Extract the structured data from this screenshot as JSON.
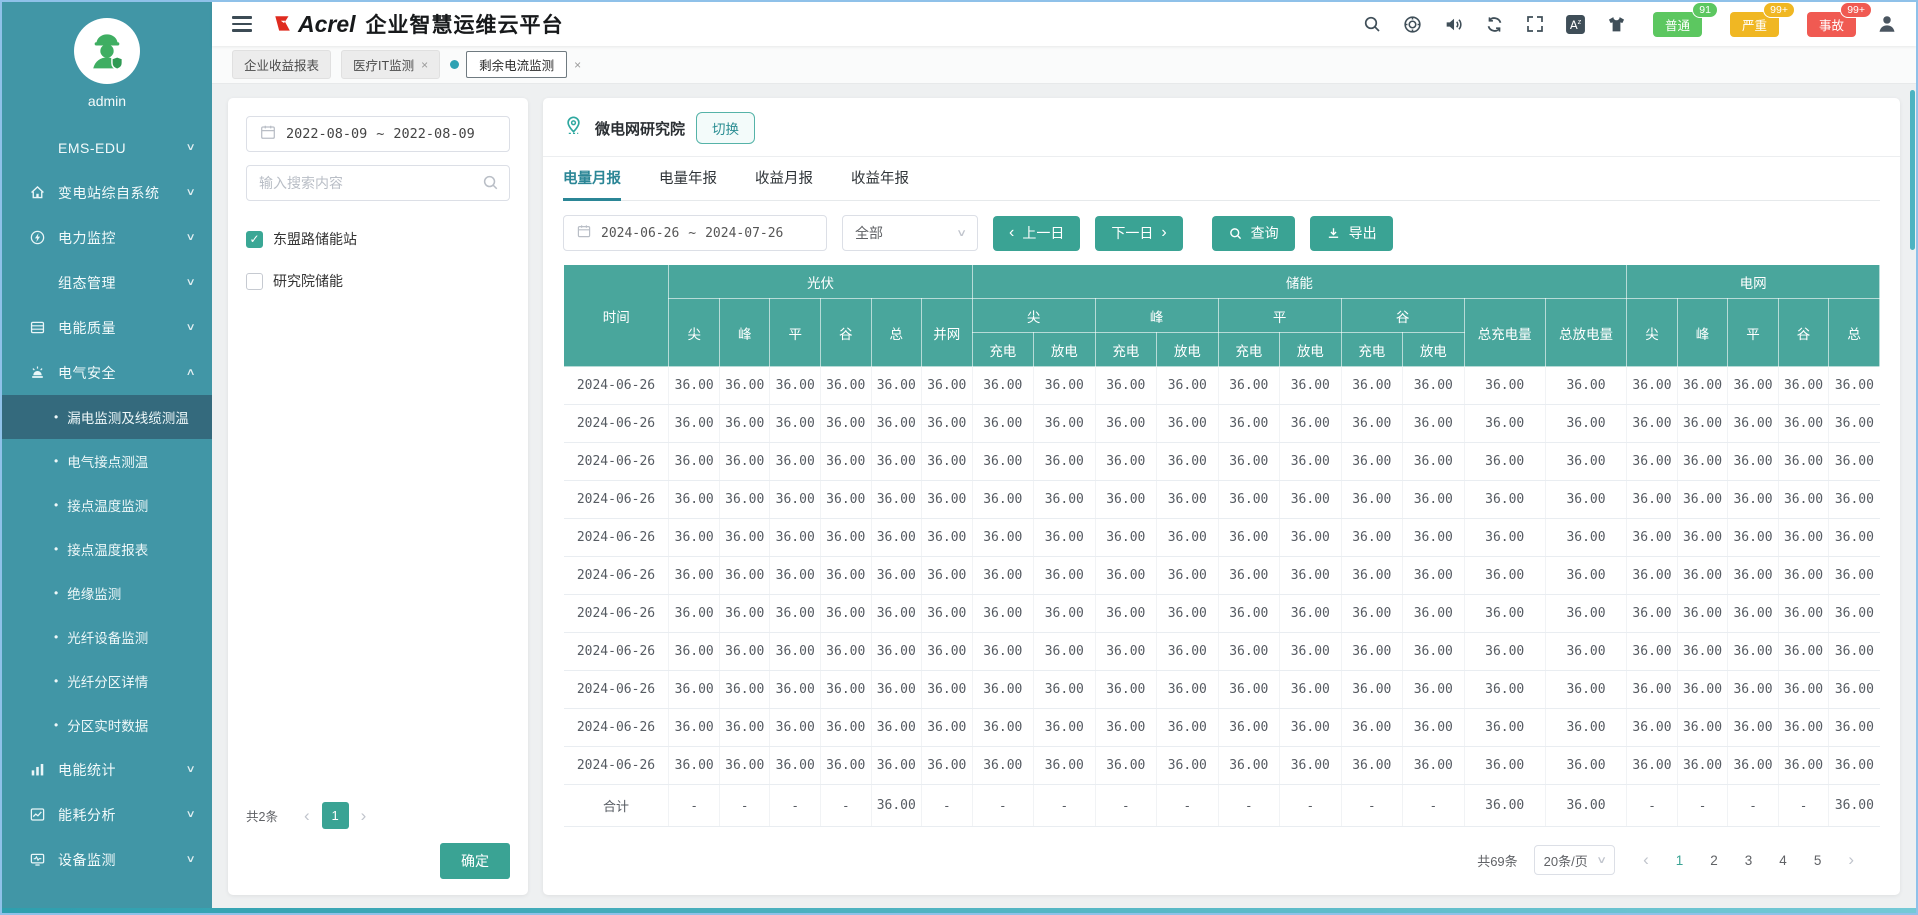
{
  "app": {
    "brand": "Acrel",
    "title": "企业智慧运维云平台"
  },
  "header": {
    "icon_names": [
      "search-icon",
      "support-icon",
      "sound-icon",
      "refresh-icon",
      "fullscreen-icon",
      "translate-icon",
      "theme-icon",
      "user-icon"
    ],
    "badges": [
      {
        "label": "普通",
        "count": "91",
        "color": "#5cc760"
      },
      {
        "label": "严重",
        "count": "99+",
        "color": "#f0b723"
      },
      {
        "label": "事故",
        "count": "99+",
        "color": "#f05a52"
      }
    ]
  },
  "workspace_tabs": [
    {
      "label": "企业收益报表",
      "active": false,
      "closable": false
    },
    {
      "label": "医疗IT监测",
      "active": false,
      "closable": true
    },
    {
      "label": "剩余电流监测",
      "active": true,
      "closable": true
    }
  ],
  "sidebar": {
    "username": "admin",
    "menu": [
      {
        "label": "EMS-EDU",
        "icon": "",
        "chevron": "down"
      },
      {
        "label": "变电站综自系统",
        "icon": "home-icon",
        "chevron": "down"
      },
      {
        "label": "电力监控",
        "icon": "power-icon",
        "chevron": "down"
      },
      {
        "label": "组态管理",
        "icon": "",
        "chevron": "down"
      },
      {
        "label": "电能质量",
        "icon": "quality-icon",
        "chevron": "down"
      },
      {
        "label": "电气安全",
        "icon": "safety-icon",
        "chevron": "up",
        "expanded": true,
        "children": [
          {
            "label": "漏电监测及线缆测温",
            "active": true
          },
          {
            "label": "电气接点测温"
          },
          {
            "label": "接点温度监测"
          },
          {
            "label": "接点温度报表"
          },
          {
            "label": "绝缘监测"
          },
          {
            "label": "光纤设备监测"
          },
          {
            "label": "光纤分区详情"
          },
          {
            "label": "分区实时数据"
          }
        ]
      },
      {
        "label": "电能统计",
        "icon": "stats-icon",
        "chevron": "down"
      },
      {
        "label": "能耗分析",
        "icon": "analysis-icon",
        "chevron": "down"
      },
      {
        "label": "设备监测",
        "icon": "device-icon",
        "chevron": "down"
      }
    ]
  },
  "filter_panel": {
    "date_start": "2022-08-09",
    "date_separator": "~",
    "date_end": "2022-08-09",
    "search_placeholder": "输入搜索内容",
    "stations": [
      {
        "label": "东盟路储能站",
        "checked": true
      },
      {
        "label": "研究院储能",
        "checked": false
      }
    ],
    "total_text": "共2条",
    "current_page": "1",
    "confirm_label": "确定"
  },
  "report": {
    "site_name": "微电网研究院",
    "switch_label": "切换",
    "tabs": [
      {
        "label": "电量月报",
        "active": true
      },
      {
        "label": "电量年报",
        "active": false
      },
      {
        "label": "收益月报",
        "active": false
      },
      {
        "label": "收益年报",
        "active": false
      }
    ],
    "toolbar": {
      "date_start": "2024-06-26",
      "date_separator": "~",
      "date_end": "2024-07-26",
      "scope_selected": "全部",
      "prev_label": "上一日",
      "next_label": "下一日",
      "query_label": "查询",
      "export_label": "导出"
    },
    "table": {
      "time_header": "时间",
      "groups": [
        {
          "label": "光伏",
          "leaf": [
            "尖",
            "峰",
            "平",
            "谷",
            "总",
            "并网"
          ]
        },
        {
          "label": "储能",
          "pairs": [
            {
              "label": "尖",
              "sub": [
                "充电",
                "放电"
              ]
            },
            {
              "label": "峰",
              "sub": [
                "充电",
                "放电"
              ]
            },
            {
              "label": "平",
              "sub": [
                "充电",
                "放电"
              ]
            },
            {
              "label": "谷",
              "sub": [
                "充电",
                "放电"
              ]
            }
          ],
          "tail": [
            "总充电量",
            "总放电量"
          ]
        },
        {
          "label": "电网",
          "leaf": [
            "尖",
            "峰",
            "平",
            "谷",
            "总"
          ]
        }
      ],
      "rows": [
        [
          "2024-06-26",
          "36.00",
          "36.00",
          "36.00",
          "36.00",
          "36.00",
          "36.00",
          "36.00",
          "36.00",
          "36.00",
          "36.00",
          "36.00",
          "36.00",
          "36.00",
          "36.00",
          "36.00",
          "36.00",
          "36.00",
          "36.00",
          "36.00",
          "36.00",
          "36.00"
        ],
        [
          "2024-06-26",
          "36.00",
          "36.00",
          "36.00",
          "36.00",
          "36.00",
          "36.00",
          "36.00",
          "36.00",
          "36.00",
          "36.00",
          "36.00",
          "36.00",
          "36.00",
          "36.00",
          "36.00",
          "36.00",
          "36.00",
          "36.00",
          "36.00",
          "36.00",
          "36.00"
        ],
        [
          "2024-06-26",
          "36.00",
          "36.00",
          "36.00",
          "36.00",
          "36.00",
          "36.00",
          "36.00",
          "36.00",
          "36.00",
          "36.00",
          "36.00",
          "36.00",
          "36.00",
          "36.00",
          "36.00",
          "36.00",
          "36.00",
          "36.00",
          "36.00",
          "36.00",
          "36.00"
        ],
        [
          "2024-06-26",
          "36.00",
          "36.00",
          "36.00",
          "36.00",
          "36.00",
          "36.00",
          "36.00",
          "36.00",
          "36.00",
          "36.00",
          "36.00",
          "36.00",
          "36.00",
          "36.00",
          "36.00",
          "36.00",
          "36.00",
          "36.00",
          "36.00",
          "36.00",
          "36.00"
        ],
        [
          "2024-06-26",
          "36.00",
          "36.00",
          "36.00",
          "36.00",
          "36.00",
          "36.00",
          "36.00",
          "36.00",
          "36.00",
          "36.00",
          "36.00",
          "36.00",
          "36.00",
          "36.00",
          "36.00",
          "36.00",
          "36.00",
          "36.00",
          "36.00",
          "36.00",
          "36.00"
        ],
        [
          "2024-06-26",
          "36.00",
          "36.00",
          "36.00",
          "36.00",
          "36.00",
          "36.00",
          "36.00",
          "36.00",
          "36.00",
          "36.00",
          "36.00",
          "36.00",
          "36.00",
          "36.00",
          "36.00",
          "36.00",
          "36.00",
          "36.00",
          "36.00",
          "36.00",
          "36.00"
        ],
        [
          "2024-06-26",
          "36.00",
          "36.00",
          "36.00",
          "36.00",
          "36.00",
          "36.00",
          "36.00",
          "36.00",
          "36.00",
          "36.00",
          "36.00",
          "36.00",
          "36.00",
          "36.00",
          "36.00",
          "36.00",
          "36.00",
          "36.00",
          "36.00",
          "36.00",
          "36.00"
        ],
        [
          "2024-06-26",
          "36.00",
          "36.00",
          "36.00",
          "36.00",
          "36.00",
          "36.00",
          "36.00",
          "36.00",
          "36.00",
          "36.00",
          "36.00",
          "36.00",
          "36.00",
          "36.00",
          "36.00",
          "36.00",
          "36.00",
          "36.00",
          "36.00",
          "36.00",
          "36.00"
        ],
        [
          "2024-06-26",
          "36.00",
          "36.00",
          "36.00",
          "36.00",
          "36.00",
          "36.00",
          "36.00",
          "36.00",
          "36.00",
          "36.00",
          "36.00",
          "36.00",
          "36.00",
          "36.00",
          "36.00",
          "36.00",
          "36.00",
          "36.00",
          "36.00",
          "36.00",
          "36.00"
        ],
        [
          "2024-06-26",
          "36.00",
          "36.00",
          "36.00",
          "36.00",
          "36.00",
          "36.00",
          "36.00",
          "36.00",
          "36.00",
          "36.00",
          "36.00",
          "36.00",
          "36.00",
          "36.00",
          "36.00",
          "36.00",
          "36.00",
          "36.00",
          "36.00",
          "36.00",
          "36.00"
        ],
        [
          "2024-06-26",
          "36.00",
          "36.00",
          "36.00",
          "36.00",
          "36.00",
          "36.00",
          "36.00",
          "36.00",
          "36.00",
          "36.00",
          "36.00",
          "36.00",
          "36.00",
          "36.00",
          "36.00",
          "36.00",
          "36.00",
          "36.00",
          "36.00",
          "36.00",
          "36.00"
        ]
      ],
      "total_row": [
        "合计",
        "-",
        "-",
        "-",
        "-",
        "36.00",
        "-",
        "-",
        "-",
        "-",
        "-",
        "-",
        "-",
        "-",
        "-",
        "36.00",
        "36.00",
        "-",
        "-",
        "-",
        "-",
        "36.00"
      ]
    },
    "pagination": {
      "total_text": "共69条",
      "page_size": "20条/页",
      "pages": [
        "1",
        "2",
        "3",
        "4",
        "5"
      ],
      "active_page": "1"
    }
  },
  "colors": {
    "sidebar": "#4196a6",
    "sidebar_active": "#346a7d",
    "table_header": "#49a69c",
    "button": "#3aa394",
    "accent": "#2b8696",
    "badge_normal": "#5cc760",
    "badge_severe": "#f0b723",
    "badge_accident": "#f05a52"
  }
}
